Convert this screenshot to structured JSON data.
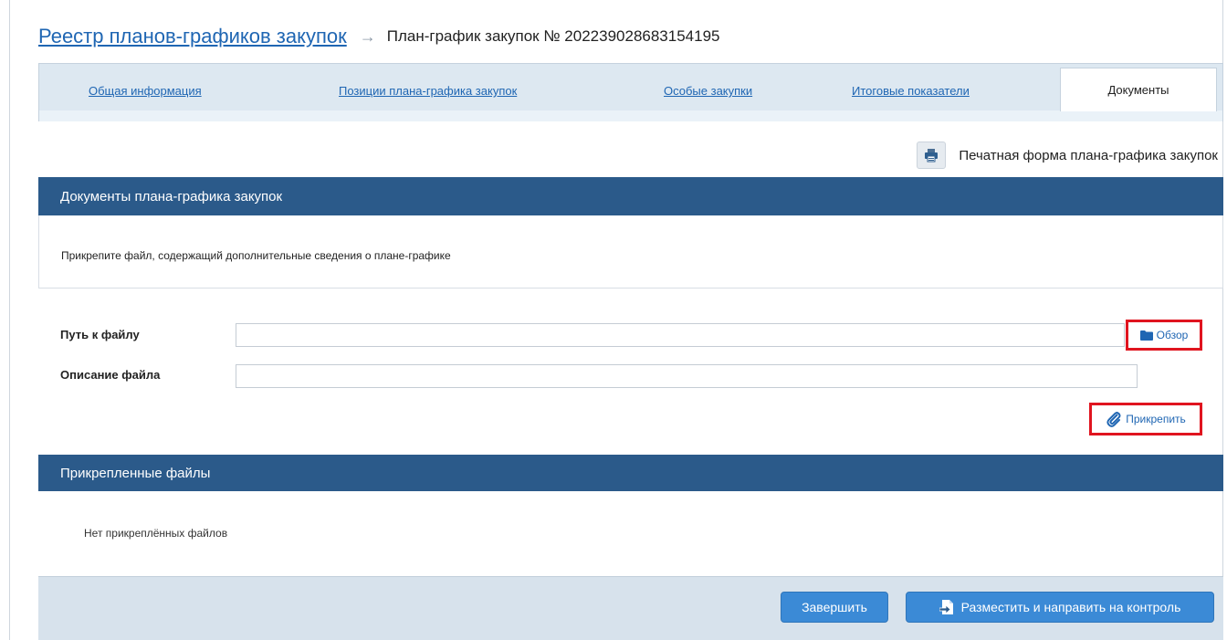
{
  "breadcrumb": {
    "parent_link": "Реестр планов-графиков закупок",
    "separator": "→",
    "current": "План-график закупок № 202239028683154195"
  },
  "tabs": [
    {
      "label": "Общая информация",
      "active": false
    },
    {
      "label": "Позиции плана-графика закупок",
      "active": false
    },
    {
      "label": "Особые закупки",
      "active": false
    },
    {
      "label": "Итоговые показатели",
      "active": false
    },
    {
      "label": "Документы",
      "active": true
    }
  ],
  "print_form": {
    "label": "Печатная форма плана-графика закупок",
    "icon": "printer-icon"
  },
  "documents_panel": {
    "title": "Документы плана-графика закупок",
    "hint": "Прикрепите файл, содержащий дополнительные сведения о плане-графике"
  },
  "form": {
    "file_path_label": "Путь к файлу",
    "file_path_value": "",
    "browse_label": "Обзор",
    "description_label": "Описание файла",
    "description_value": "",
    "attach_label": "Прикрепить"
  },
  "attached_panel": {
    "title": "Прикрепленные файлы",
    "empty_text": "Нет прикреплённых файлов"
  },
  "footer": {
    "finish_label": "Завершить",
    "publish_label": "Разместить и направить на контроль"
  },
  "colors": {
    "accent_link": "#1f66b3",
    "panel_header": "#2b5a8a",
    "primary_button": "#3b8ad6",
    "highlight_border": "#e0141f"
  }
}
